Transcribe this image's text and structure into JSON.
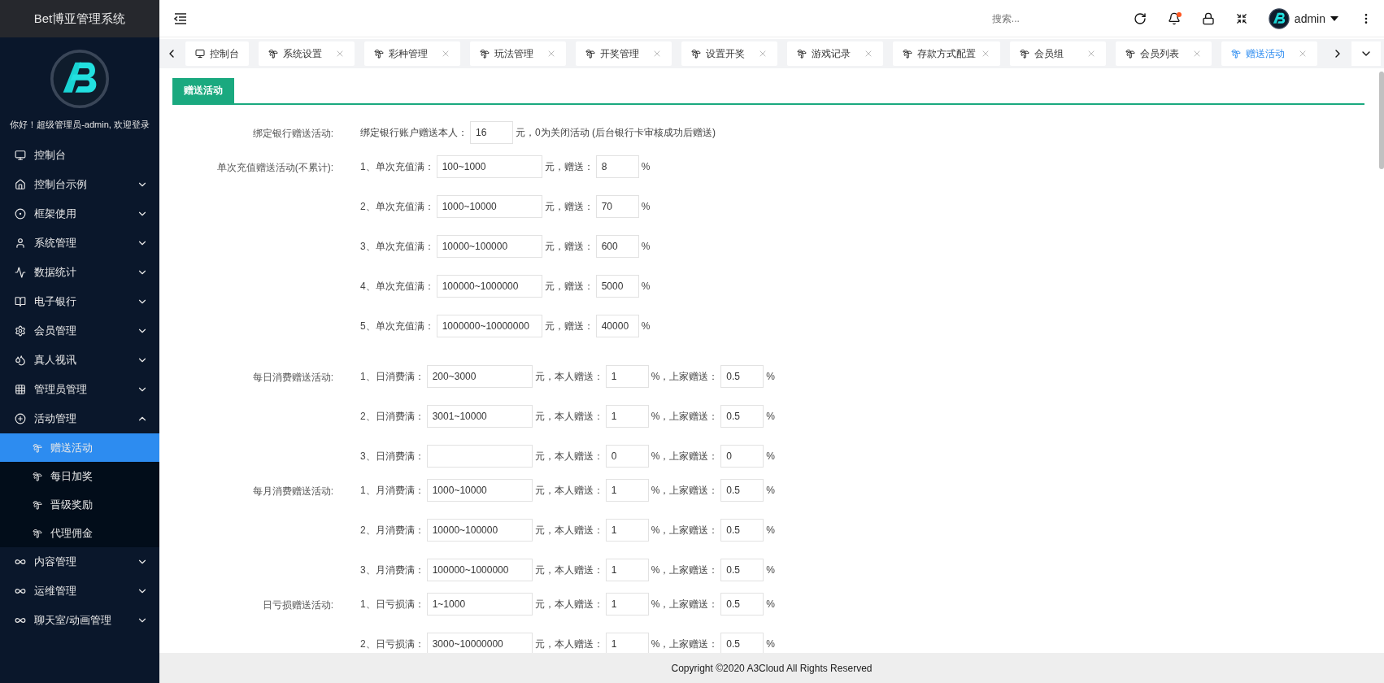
{
  "app_title": "Bet博亚管理系统",
  "greeting": "你好！超级管理员-admin, 欢迎登录",
  "menu": [
    {
      "label": "控制台",
      "kind": "link"
    },
    {
      "label": "控制台示例",
      "kind": "group",
      "expanded": false
    },
    {
      "label": "框架使用",
      "kind": "group",
      "expanded": false
    },
    {
      "label": "系统管理",
      "kind": "group",
      "expanded": false
    },
    {
      "label": "数据统计",
      "kind": "group",
      "expanded": false
    },
    {
      "label": "电子银行",
      "kind": "group",
      "expanded": false
    },
    {
      "label": "会员管理",
      "kind": "group",
      "expanded": false
    },
    {
      "label": "真人视讯",
      "kind": "group",
      "expanded": false
    },
    {
      "label": "管理员管理",
      "kind": "group",
      "expanded": false
    },
    {
      "label": "活动管理",
      "kind": "group",
      "expanded": true,
      "children": [
        {
          "label": "赠送活动",
          "selected": true
        },
        {
          "label": "每日加奖",
          "selected": false
        },
        {
          "label": "晋级奖励",
          "selected": false
        },
        {
          "label": "代理佣金",
          "selected": false
        }
      ]
    },
    {
      "label": "内容管理",
      "kind": "group",
      "expanded": false
    },
    {
      "label": "运维管理",
      "kind": "group",
      "expanded": false
    },
    {
      "label": "聊天室/动画管理",
      "kind": "group",
      "expanded": false
    }
  ],
  "header": {
    "search": {
      "placeholder": "搜索..."
    },
    "notification": true,
    "user": "admin"
  },
  "tabs": [
    {
      "label": "控制台",
      "kind": "home",
      "selected": false
    },
    {
      "label": "系统设置",
      "kind": "page",
      "selected": false
    },
    {
      "label": "彩种管理",
      "kind": "page",
      "selected": false
    },
    {
      "label": "玩法管理",
      "kind": "page",
      "selected": false
    },
    {
      "label": "开奖管理",
      "kind": "page",
      "selected": false
    },
    {
      "label": "设置开奖",
      "kind": "page",
      "selected": false
    },
    {
      "label": "游戏记录",
      "kind": "page",
      "selected": false
    },
    {
      "label": "存款方式配置",
      "kind": "page",
      "selected": false
    },
    {
      "label": "会员组",
      "kind": "page",
      "selected": false
    },
    {
      "label": "会员列表",
      "kind": "page",
      "selected": false
    },
    {
      "label": "赠送活动",
      "kind": "page",
      "selected": true
    }
  ],
  "panel_title": "赠送活动",
  "sections": [
    {
      "label": "绑定银行赠送活动:",
      "rows": [
        [
          {
            "kind": "text",
            "text": "绑定银行账户赠送本人："
          },
          {
            "kind": "small_input",
            "value": "16"
          },
          {
            "kind": "text",
            "text": "元，0为关闭活动 (后台银行卡审核成功后赠送)"
          }
        ]
      ]
    },
    {
      "label": "单次充值赠送活动(不累计):",
      "rows": [
        [
          {
            "kind": "text",
            "text": "1、单次充值满："
          },
          {
            "kind": "range_input",
            "value": "100~1000"
          },
          {
            "kind": "text",
            "text": "元，赠送："
          },
          {
            "kind": "small_input",
            "value": "8"
          },
          {
            "kind": "text",
            "text": "%"
          }
        ],
        [
          {
            "kind": "text",
            "text": "2、单次充值满："
          },
          {
            "kind": "range_input",
            "value": "1000~10000"
          },
          {
            "kind": "text",
            "text": "元，赠送："
          },
          {
            "kind": "small_input",
            "value": "70"
          },
          {
            "kind": "text",
            "text": "%"
          }
        ],
        [
          {
            "kind": "text",
            "text": "3、单次充值满："
          },
          {
            "kind": "range_input",
            "value": "10000~100000"
          },
          {
            "kind": "text",
            "text": "元，赠送："
          },
          {
            "kind": "small_input",
            "value": "600"
          },
          {
            "kind": "text",
            "text": "%"
          }
        ],
        [
          {
            "kind": "text",
            "text": "4、单次充值满："
          },
          {
            "kind": "range_input",
            "value": "100000~1000000"
          },
          {
            "kind": "text",
            "text": "元，赠送："
          },
          {
            "kind": "small_input",
            "value": "5000"
          },
          {
            "kind": "text",
            "text": "%"
          }
        ],
        [
          {
            "kind": "text",
            "text": "5、单次充值满："
          },
          {
            "kind": "range_input",
            "value": "1000000~10000000"
          },
          {
            "kind": "text",
            "text": "元，赠送："
          },
          {
            "kind": "small_input",
            "value": "40000"
          },
          {
            "kind": "text",
            "text": "%"
          }
        ]
      ]
    },
    {
      "label": "每日消费赠送活动:",
      "rows": [
        [
          {
            "kind": "text",
            "text": "1、日消费满："
          },
          {
            "kind": "range_input",
            "value": "200~3000"
          },
          {
            "kind": "text",
            "text": "元，本人赠送："
          },
          {
            "kind": "small_input",
            "value": "1"
          },
          {
            "kind": "text",
            "text": "%，上家赠送："
          },
          {
            "kind": "small_input",
            "value": "0.5"
          },
          {
            "kind": "text",
            "text": "%"
          }
        ],
        [
          {
            "kind": "text",
            "text": "2、日消费满："
          },
          {
            "kind": "range_input",
            "value": "3001~10000"
          },
          {
            "kind": "text",
            "text": "元，本人赠送："
          },
          {
            "kind": "small_input",
            "value": "1"
          },
          {
            "kind": "text",
            "text": "%，上家赠送："
          },
          {
            "kind": "small_input",
            "value": "0.5"
          },
          {
            "kind": "text",
            "text": "%"
          }
        ],
        [
          {
            "kind": "text",
            "text": "3、日消费满："
          },
          {
            "kind": "range_input"
          },
          {
            "kind": "text",
            "text": "元，本人赠送："
          },
          {
            "kind": "small_input",
            "value": "0"
          },
          {
            "kind": "text",
            "text": "%，上家赠送："
          },
          {
            "kind": "small_input",
            "value": "0"
          },
          {
            "kind": "text",
            "text": "%"
          }
        ]
      ]
    },
    {
      "label": "每月消费赠送活动:",
      "rows": [
        [
          {
            "kind": "text",
            "text": "1、月消费满："
          },
          {
            "kind": "range_input",
            "value": "1000~10000"
          },
          {
            "kind": "text",
            "text": "元，本人赠送："
          },
          {
            "kind": "small_input",
            "value": "1"
          },
          {
            "kind": "text",
            "text": "%，上家赠送："
          },
          {
            "kind": "small_input",
            "value": "0.5"
          },
          {
            "kind": "text",
            "text": "%"
          }
        ],
        [
          {
            "kind": "text",
            "text": "2、月消费满："
          },
          {
            "kind": "range_input",
            "value": "10000~100000"
          },
          {
            "kind": "text",
            "text": "元，本人赠送："
          },
          {
            "kind": "small_input",
            "value": "1"
          },
          {
            "kind": "text",
            "text": "%，上家赠送："
          },
          {
            "kind": "small_input",
            "value": "0.5"
          },
          {
            "kind": "text",
            "text": "%"
          }
        ],
        [
          {
            "kind": "text",
            "text": "3、月消费满："
          },
          {
            "kind": "range_input",
            "value": "100000~1000000"
          },
          {
            "kind": "text",
            "text": "元，本人赠送："
          },
          {
            "kind": "small_input",
            "value": "1"
          },
          {
            "kind": "text",
            "text": "%，上家赠送："
          },
          {
            "kind": "small_input",
            "value": "0.5"
          },
          {
            "kind": "text",
            "text": "%"
          }
        ]
      ]
    },
    {
      "label": "日亏损赠送活动:",
      "rows": [
        [
          {
            "kind": "text",
            "text": "1、日亏损满："
          },
          {
            "kind": "range_input",
            "value": "1~1000"
          },
          {
            "kind": "text",
            "text": "元，本人赠送："
          },
          {
            "kind": "small_input",
            "value": "1"
          },
          {
            "kind": "text",
            "text": "%，上家赠送："
          },
          {
            "kind": "small_input",
            "value": "0.5"
          },
          {
            "kind": "text",
            "text": "%"
          }
        ],
        [
          {
            "kind": "text",
            "text": "2、日亏损满："
          },
          {
            "kind": "range_input",
            "value": "3000~10000000"
          },
          {
            "kind": "text",
            "text": "元，本人赠送："
          },
          {
            "kind": "small_input",
            "value": "1"
          },
          {
            "kind": "text",
            "text": "%，上家赠送："
          },
          {
            "kind": "small_input",
            "value": "0.5"
          },
          {
            "kind": "text",
            "text": "%"
          }
        ]
      ]
    }
  ],
  "footer": "Copyright ©2020 A3Cloud All Rights Reserved"
}
